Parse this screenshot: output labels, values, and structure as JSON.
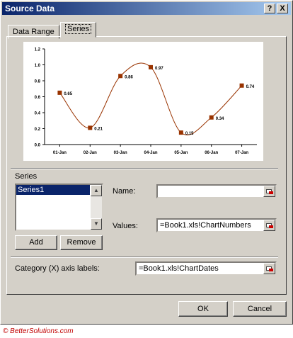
{
  "window": {
    "title": "Source Data",
    "help_button": "?",
    "close_button": "X"
  },
  "tabs": [
    {
      "label": "Data Range"
    },
    {
      "label": "Series"
    }
  ],
  "chart_data": {
    "type": "line",
    "categories": [
      "01-Jan",
      "02-Jan",
      "03-Jan",
      "04-Jan",
      "05-Jan",
      "06-Jan",
      "07-Jan"
    ],
    "values": [
      0.65,
      0.21,
      0.86,
      0.97,
      0.15,
      0.34,
      0.74
    ],
    "data_labels": [
      "0.65",
      "0.21",
      "0.86",
      "0.97",
      "0.15",
      "0.34",
      "0.74"
    ],
    "y_ticks": [
      "0.0",
      "0.2",
      "0.4",
      "0.6",
      "0.8",
      "1.0",
      "1.2"
    ],
    "ylim": [
      0,
      1.2
    ],
    "smoothed": true,
    "line_color": "#993300",
    "marker_color": "#993300",
    "title": "",
    "xlabel": "",
    "ylabel": ""
  },
  "series": {
    "group_label": "Series",
    "items": [
      "Series1"
    ],
    "add_label": "Add",
    "remove_label": "Remove",
    "name_label": "Name:",
    "name_value": "",
    "values_label": "Values:",
    "values_value": "=Book1.xls!ChartNumbers"
  },
  "category": {
    "label": "Category (X) axis labels:",
    "value": "=Book1.xls!ChartDates"
  },
  "buttons": {
    "ok": "OK",
    "cancel": "Cancel"
  },
  "footer": {
    "copyright": "© BetterSolutions.com"
  }
}
